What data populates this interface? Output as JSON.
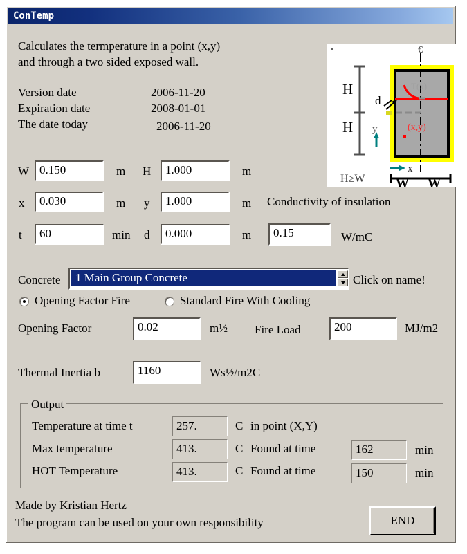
{
  "window": {
    "title": "ConTemp"
  },
  "description": {
    "line1": "Calculates the termperature in a point (x,y)",
    "line2": "and through a two sided exposed wall."
  },
  "dates": [
    {
      "label": "Version date",
      "value": "2006-11-20"
    },
    {
      "label": "Expiration date",
      "value": "2008-01-01"
    },
    {
      "label": "The date today",
      "value": "2006-11-20"
    }
  ],
  "inputs": {
    "w": {
      "label": "W",
      "value": "0.150",
      "unit": "m"
    },
    "h": {
      "label": "H",
      "value": "1.000",
      "unit": "m"
    },
    "x": {
      "label": "x",
      "value": "0.030",
      "unit": "m"
    },
    "y": {
      "label": "y",
      "value": "1.000",
      "unit": "m"
    },
    "t": {
      "label": "t",
      "value": "60",
      "unit": "min"
    },
    "d": {
      "label": "d",
      "value": "0.000",
      "unit": "m"
    },
    "conductivity": {
      "label": "Conductivity of insulation",
      "value": "0.15",
      "unit": "W/mC"
    }
  },
  "concrete": {
    "label": "Concrete",
    "selected": "1    Main Group Concrete",
    "hint": "Click on name!"
  },
  "fire_mode": {
    "option_opening_factor": "Opening Factor Fire",
    "option_standard_cooling": "Standard Fire With Cooling",
    "selected": "opening_factor"
  },
  "fire_params": {
    "opening_factor": {
      "label": "Opening Factor",
      "value": "0.02",
      "unit": "m½"
    },
    "fire_load": {
      "label": "Fire Load",
      "value": "200",
      "unit": "MJ/m2"
    },
    "thermal_inertia": {
      "label": "Thermal Inertia b",
      "value": "1160",
      "unit": "Ws½/m2C"
    }
  },
  "output": {
    "legend": "Output",
    "rows": [
      {
        "label": "Temperature at time t",
        "value": "257.",
        "unit": "C",
        "suffix": "in point (X,Y)",
        "time_value": null,
        "time_unit": null
      },
      {
        "label": "Max temperature",
        "value": "413.",
        "unit": "C",
        "suffix": "Found at time",
        "time_value": "162",
        "time_unit": "min"
      },
      {
        "label": "HOT Temperature",
        "value": "413.",
        "unit": "C",
        "suffix": "Found at time",
        "time_value": "150",
        "time_unit": "min"
      }
    ]
  },
  "footer": {
    "line1": "Made by Kristian Hertz",
    "line2": "The program can be used on your own responsibility",
    "end_button": "END"
  },
  "diagram": {
    "label_h_top": "H",
    "label_h_bottom": "H",
    "label_d": "d",
    "label_y": "y",
    "label_x": "x",
    "label_centerline": "€",
    "label_point": "(x,y)",
    "label_tx": "T(x)",
    "label_constraint": "H≥W",
    "label_w_left": "W",
    "label_w_right": "W",
    "colors": {
      "insulation": "#ffff00",
      "concrete_fill": "#a8a8a8",
      "concrete_outline": "#000000",
      "temperature_line": "#ff0000",
      "axis_arrow": "#008080"
    }
  },
  "theme": {
    "window_face": "#d4d0c8",
    "title_gradient_start": "#0a246a",
    "title_gradient_end": "#a6c8f0",
    "selection_blue": "#10287a",
    "text": "#000000"
  }
}
